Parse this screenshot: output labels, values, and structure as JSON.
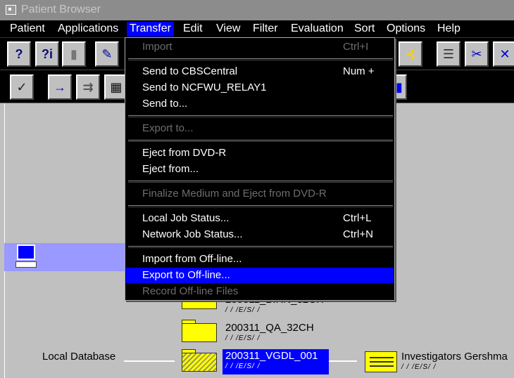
{
  "window": {
    "title": "Patient Browser"
  },
  "menubar": [
    {
      "label": "Patient"
    },
    {
      "label": "Applications"
    },
    {
      "label": "Transfer"
    },
    {
      "label": "Edit"
    },
    {
      "label": "View"
    },
    {
      "label": "Filter"
    },
    {
      "label": "Evaluation"
    },
    {
      "label": "Sort"
    },
    {
      "label": "Options"
    },
    {
      "label": "Help"
    }
  ],
  "transfer_menu": {
    "import": {
      "label": "Import",
      "shortcut": "Ctrl+I",
      "enabled": false
    },
    "send_cbs": {
      "label": "Send to CBSCentral",
      "shortcut": "Num +"
    },
    "send_relay": {
      "label": "Send to NCFWU_RELAY1"
    },
    "send_to": {
      "label": "Send to..."
    },
    "export_to": {
      "label": "Export to...",
      "enabled": false
    },
    "eject_dvd": {
      "label": "Eject from DVD-R"
    },
    "eject_from": {
      "label": "Eject from..."
    },
    "finalize": {
      "label": "Finalize Medium and Eject from DVD-R",
      "enabled": false
    },
    "local_job": {
      "label": "Local Job Status...",
      "shortcut": "Ctrl+L"
    },
    "network_job": {
      "label": "Network Job Status...",
      "shortcut": "Ctrl+N"
    },
    "import_offline": {
      "label": "Import from Off-line..."
    },
    "export_offline": {
      "label": "Export to Off-line...",
      "highlighted": true
    },
    "record_offline": {
      "label": "Record Off-line Files",
      "enabled": false
    }
  },
  "tree": {
    "local_database": "Local Database",
    "nodes": [
      {
        "label": "200311_BIRN_32CH",
        "sub": "/ / /E/S/  /"
      },
      {
        "label": "200311_QA_32CH",
        "sub": "/ / /E/S/  /"
      },
      {
        "label": "200311_VGDL_001",
        "sub": "/ / /E/S/  /",
        "selected": true
      }
    ],
    "investigator": {
      "label": "Investigators Gershma",
      "sub": "/ / /E/S/  /"
    }
  },
  "colors": {
    "selection": "#0000ff",
    "row_highlight": "#9999ff",
    "folder": "#ffff00",
    "background": "#c0c0c0"
  }
}
